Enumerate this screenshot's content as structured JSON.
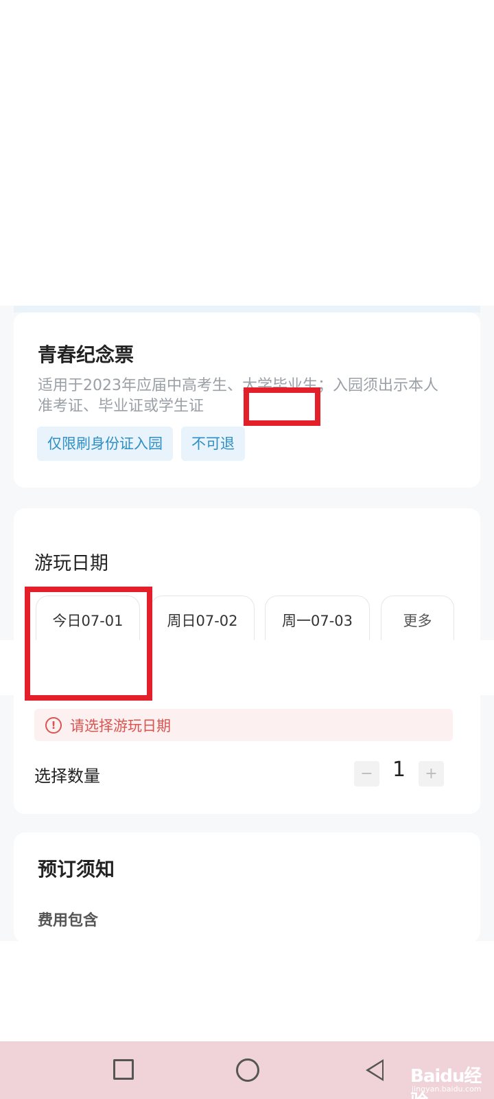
{
  "ticket": {
    "title": "青春纪念票",
    "description": "适用于2023年应届中高考生、大学毕业生；入园须出示本人准考证、毕业证或学生证",
    "tags": [
      "仅限刷身份证入园",
      "不可退"
    ]
  },
  "date_section": {
    "title": "游玩日期",
    "dates": [
      "今日07-01",
      "周日07-02",
      "周一07-03",
      "更多"
    ],
    "warning_icon": "!",
    "warning": "请选择游玩日期"
  },
  "quantity": {
    "label": "选择数量",
    "minus": "−",
    "value": "1",
    "plus": "+"
  },
  "notice": {
    "title": "预订须知",
    "fee_title": "费用包含"
  },
  "watermark": {
    "text": "Baidu经验",
    "sub": "jingyan.baidu.com"
  },
  "colors": {
    "highlight": "#e3202a",
    "tag_bg": "#e8f3fb",
    "tag_text": "#2e8ec5",
    "warning_bg": "#fdf0f0",
    "warning_text": "#d9534f",
    "navbar_bg": "#efd3d8"
  },
  "icons": [
    "warning-circle-icon",
    "minus-icon",
    "plus-icon",
    "recent-apps-icon",
    "home-icon",
    "back-icon"
  ]
}
